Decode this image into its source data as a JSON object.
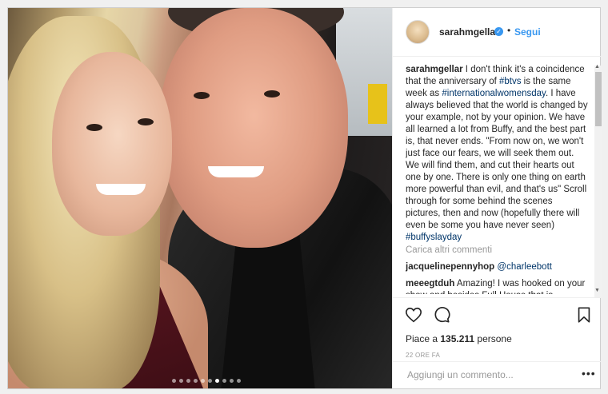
{
  "post": {
    "username": "sarahmgellar",
    "separator": "•",
    "follow_label": "Segui",
    "caption_user": "sarahmgellar",
    "caption_text_1": " I don't think it's a coincidence that the anniversary of ",
    "caption_tag_1": "#btvs",
    "caption_text_2": " is the same week as ",
    "caption_tag_2": "#internationalwomensday",
    "caption_text_3": ". I have always believed that the world is changed by your example, not by your opinion. We have all learned a lot from Buffy, and the best part is, that never ends. \"From now on, we won't just face our fears, we will seek them out. We will find them, and cut their hearts out one by one. There is only one thing on earth more powerful than evil, and that's us\" Scroll through for some behind the scenes pictures, then and now (hopefully there will even be some you have never seen) ",
    "caption_tag_3": "#buffyslayday",
    "load_more": "Carica altri commenti",
    "comments": [
      {
        "user": "jacquelinepennyhop",
        "text": "@charleebott"
      },
      {
        "user": "meeegtduh",
        "text": "Amazing! I was hooked on your show and besides Full House that is"
      }
    ],
    "likes_prefix": "Piace a ",
    "likes_count": "135.211",
    "likes_suffix": " persone",
    "time": "22 ORE FA",
    "add_comment_placeholder": "Aggiungi un commento...",
    "more_label": "•••"
  },
  "carousel": {
    "total": 10,
    "active": 7
  },
  "icons": [
    "heart-icon",
    "comment-icon",
    "bookmark-icon",
    "verified-icon",
    "more-options-icon"
  ],
  "colors": {
    "link_blue": "#3897f0",
    "hashtag": "#003569",
    "muted": "#999999"
  }
}
